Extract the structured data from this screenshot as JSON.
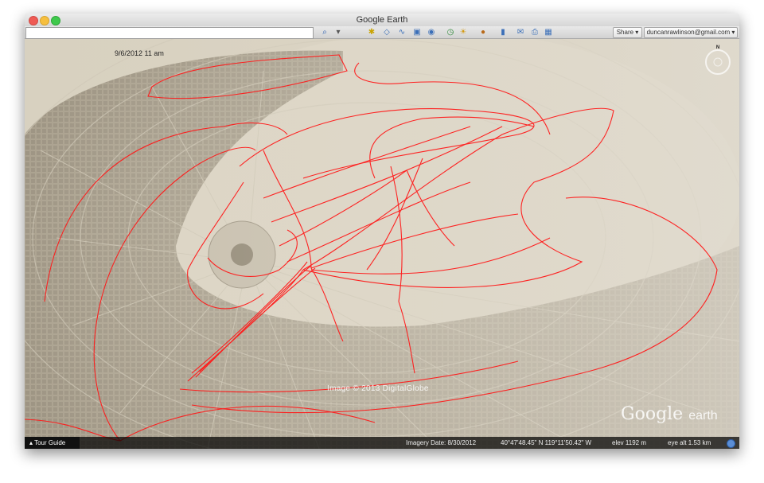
{
  "window": {
    "title": "Google Earth"
  },
  "toolbar": {
    "search_value": "",
    "share_label": "Share ▾",
    "account_label": "duncanrawlinson@gmail.com ▾",
    "icons": [
      "search-icon",
      "placemark-icon",
      "polygon-icon",
      "path-icon",
      "overlay-icon",
      "record-tour-icon",
      "historical-imagery-icon",
      "sunlight-icon",
      "planets-icon",
      "ruler-icon",
      "email-icon",
      "print-icon",
      "view-in-maps-icon"
    ]
  },
  "map": {
    "datestamp": "9/6/2012  11 am",
    "copyright": "Image © 2013 DigitalGlobe",
    "logo_text": "Google",
    "logo_suffix": "earth",
    "compass_label": "N",
    "track_color": "#ff1a1a"
  },
  "statusbar": {
    "tour_guide": "Tour Guide",
    "imagery_date": "Imagery Date: 8/30/2012",
    "coords": "40°47'48.45\" N  119°11'50.42\" W",
    "elev": "elev  1192 m",
    "eye_alt": "eye alt   1.53 km"
  }
}
